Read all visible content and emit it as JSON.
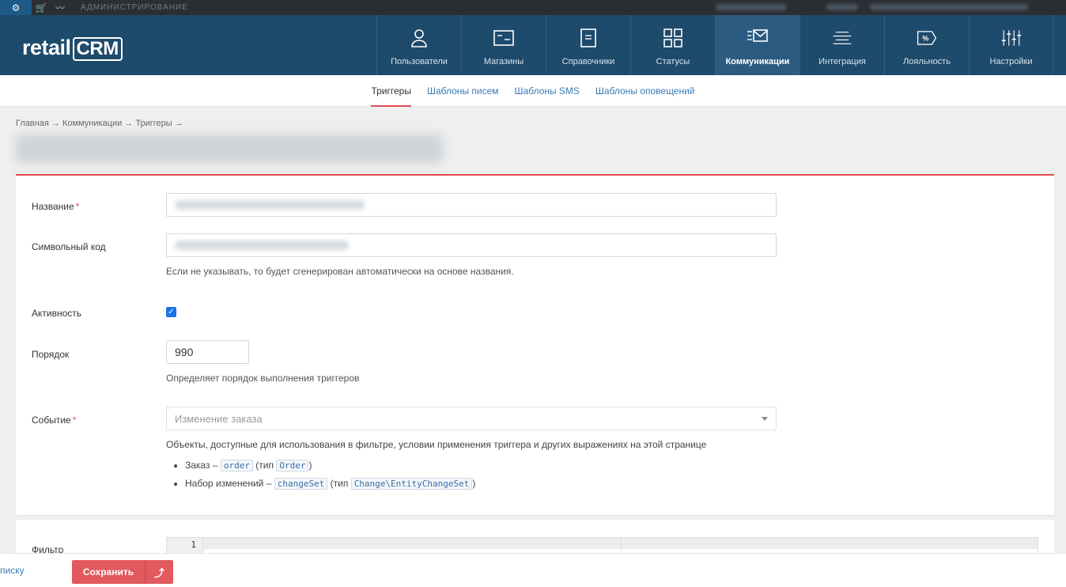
{
  "admin_strip": {
    "label": "АДМИНИСТРИРОВАНИЕ"
  },
  "logo": {
    "text": "retail",
    "crm": "CRM"
  },
  "nav": [
    {
      "label": "Пользователи",
      "icon": "user-icon"
    },
    {
      "label": "Магазины",
      "icon": "store-icon"
    },
    {
      "label": "Справочники",
      "icon": "book-icon"
    },
    {
      "label": "Статусы",
      "icon": "statuses-icon"
    },
    {
      "label": "Коммуникации",
      "icon": "communications-icon",
      "active": true
    },
    {
      "label": "Интеграция",
      "icon": "integration-icon"
    },
    {
      "label": "Лояльность",
      "icon": "loyalty-icon"
    },
    {
      "label": "Настройки",
      "icon": "settings-sliders-icon"
    }
  ],
  "subnav": [
    {
      "label": "Триггеры",
      "active": true
    },
    {
      "label": "Шаблоны писем"
    },
    {
      "label": "Шаблоны SMS"
    },
    {
      "label": "Шаблоны оповещений"
    }
  ],
  "breadcrumb": "Главная → Коммуникации → Триггеры →",
  "form": {
    "name_label": "Название",
    "code_label": "Символьный код",
    "code_hint": "Если не указывать, то будет сгенерирован автоматически на основе названия.",
    "active_label": "Активность",
    "active_checked": true,
    "order_label": "Порядок",
    "order_value": "990",
    "order_hint": "Определяет порядок выполнения триггеров",
    "event_label": "Событие",
    "event_placeholder": "Изменение заказа",
    "objects_hint": "Объекты, доступные для использования в фильтре, условии применения триггера и других выражениях на этой странице",
    "objects": [
      {
        "prefix": "Заказ – ",
        "var": "order",
        "type_prefix": " (тип ",
        "type": "Order",
        "suffix": ")"
      },
      {
        "prefix": "Набор изменений – ",
        "var": "changeSet",
        "type_prefix": " (тип ",
        "type": "Change\\EntityChangeSet",
        "suffix": ")"
      }
    ],
    "filter_label": "Фильтр",
    "editor_line": "1"
  },
  "bottom": {
    "back_link": "писку",
    "save_label": "Сохранить",
    "up_icon": "⤴"
  },
  "colors": {
    "header": "#1e4a6b",
    "accent": "#e04a50",
    "link": "#3b7bb3"
  }
}
